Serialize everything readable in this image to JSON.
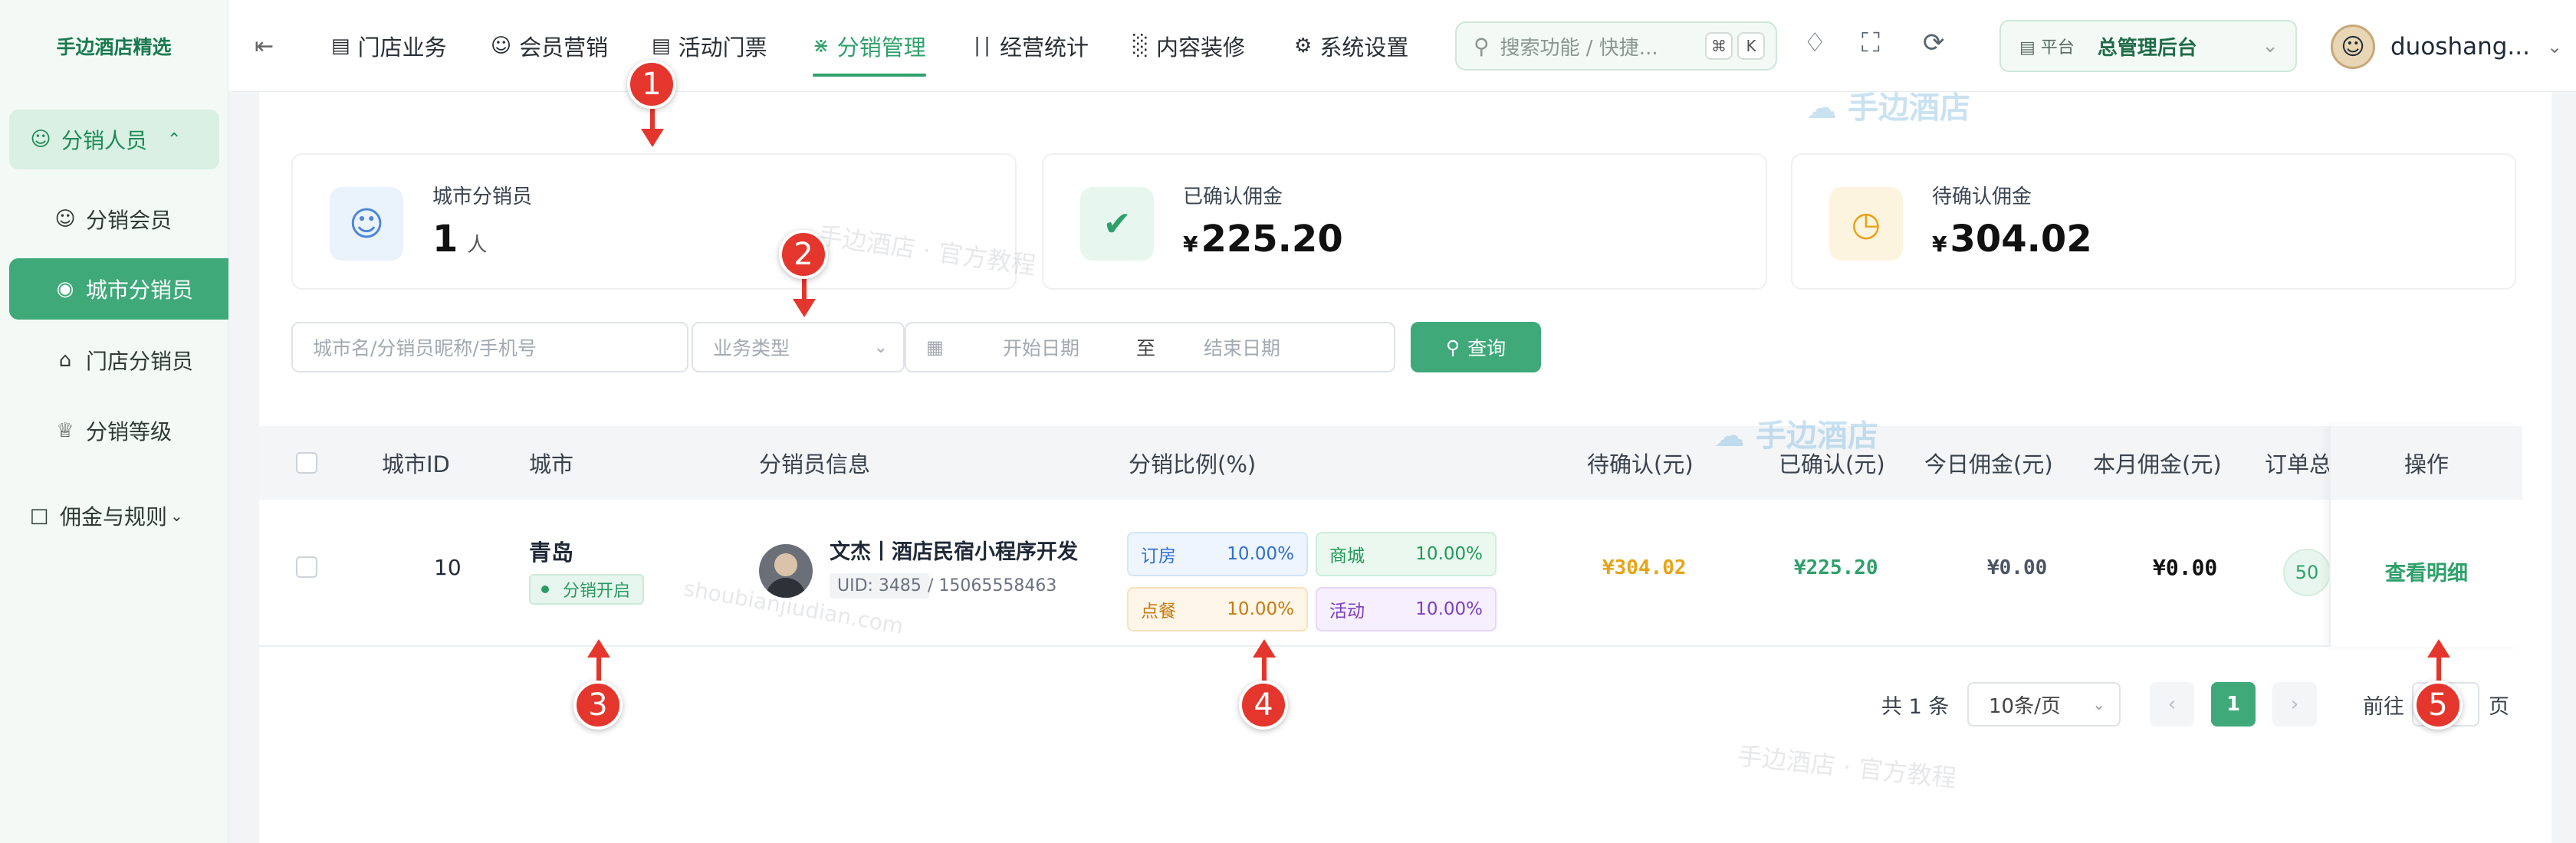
{
  "app": {
    "logo": "手边酒店精选"
  },
  "sidebar": {
    "group1": "分销人员",
    "items": [
      {
        "label": "分销会员"
      },
      {
        "label": "城市分销员"
      },
      {
        "label": "门店分销员"
      },
      {
        "label": "分销等级"
      }
    ],
    "group2": "佣金与规则"
  },
  "nav": {
    "items": [
      {
        "label": "门店业务"
      },
      {
        "label": "会员营销"
      },
      {
        "label": "活动门票"
      },
      {
        "label": "分销管理"
      },
      {
        "label": "经营统计"
      },
      {
        "label": "内容装修"
      },
      {
        "label": "系统设置"
      }
    ],
    "active": "分销管理"
  },
  "search": {
    "placeholder": "搜索功能 / 快捷...",
    "key1": "⌘",
    "key2": "K"
  },
  "platform": {
    "tag": "平台",
    "name": "总管理后台"
  },
  "user": {
    "name": "duoshang..."
  },
  "stats": [
    {
      "label": "城市分销员",
      "value": "1",
      "unit": "人"
    },
    {
      "label": "已确认佣金",
      "currency": "¥",
      "value": "225.20"
    },
    {
      "label": "待确认佣金",
      "currency": "¥",
      "value": "304.02"
    }
  ],
  "filters": {
    "keyword_placeholder": "城市名/分销员昵称/手机号",
    "type_placeholder": "业务类型",
    "start_placeholder": "开始日期",
    "sep": "至",
    "end_placeholder": "结束日期",
    "query": "查询"
  },
  "table": {
    "headers": [
      "城市ID",
      "城市",
      "分销员信息",
      "分销比例(%)",
      "待确认(元)",
      "已确认(元)",
      "今日佣金(元)",
      "本月佣金(元)",
      "订单总数",
      "操作"
    ],
    "rows": [
      {
        "id": "10",
        "city": "青岛",
        "status": "分销开启",
        "name": "文杰丨酒店民宿小程序开发",
        "uid": "UID: 3485",
        "phone": "/ 15065558463",
        "rates": [
          {
            "label": "订房",
            "value": "10.00%"
          },
          {
            "label": "商城",
            "value": "10.00%"
          },
          {
            "label": "点餐",
            "value": "10.00%"
          },
          {
            "label": "活动",
            "value": "10.00%"
          }
        ],
        "pending": "¥304.02",
        "confirmed": "¥225.20",
        "today": "¥0.00",
        "month": "¥0.00",
        "orders": "50",
        "action": "查看明细"
      }
    ]
  },
  "pagination": {
    "total": "共 1 条",
    "size": "10条/页",
    "current": "1",
    "goto": "前往",
    "page_suffix": "页"
  },
  "watermarks": {
    "brand": "手边酒店",
    "official": "手边酒店 · 官方教程",
    "url": "shoubianjiudian.com"
  },
  "annotations": [
    "1",
    "2",
    "3",
    "4",
    "5"
  ],
  "colors": {
    "accent": "#3fa97a",
    "warning": "#e8a317",
    "annotation": "#e5362d"
  }
}
